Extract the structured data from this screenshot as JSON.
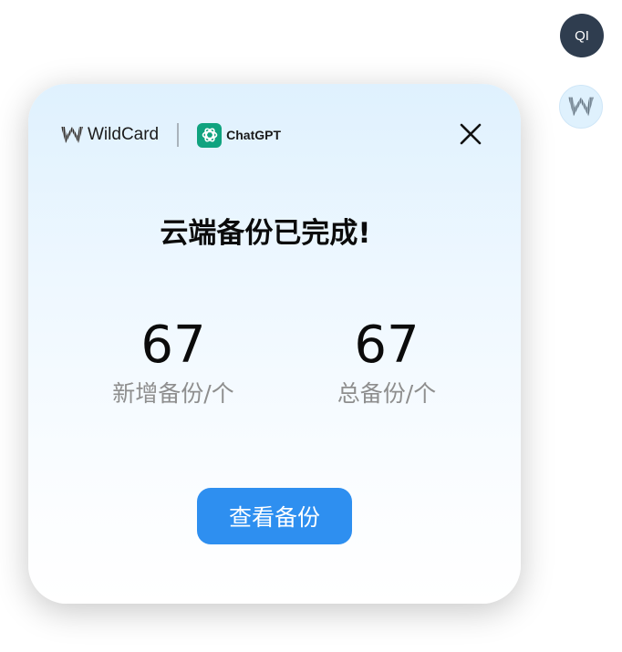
{
  "avatars": {
    "user_initials": "QI",
    "extension_icon": "wildcard-w-icon"
  },
  "header": {
    "brand_name": "WildCard",
    "partner_name": "ChatGPT",
    "brand_icon": "wildcard-logo-icon",
    "partner_icon": "chatgpt-logo-icon",
    "close_icon": "close-icon"
  },
  "dialog": {
    "title": "云端备份已完成!",
    "stats": [
      {
        "value": "67",
        "label": "新增备份/个"
      },
      {
        "value": "67",
        "label": "总备份/个"
      }
    ],
    "action_label": "查看备份"
  },
  "colors": {
    "primary_button": "#2e8ff0",
    "card_gradient_top": "#dff1fe",
    "avatar_dark": "#2f3d4f",
    "chatgpt_green": "#10a37f"
  }
}
